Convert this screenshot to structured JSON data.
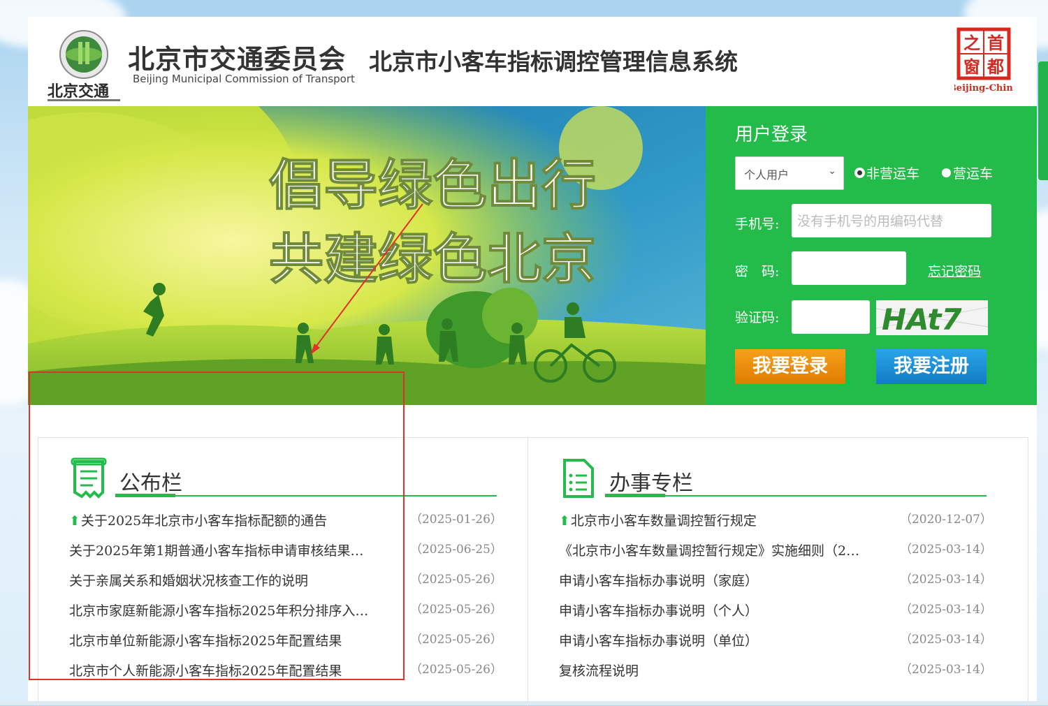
{
  "header": {
    "org_cn": "北京市交通委员会",
    "org_en": "Beijing Municipal Commission of Transport",
    "logo_text": "北京交通",
    "system_title": "北京市小客车指标调控管理信息系统",
    "stamp_chars": [
      "之",
      "首",
      "窗",
      "都"
    ],
    "stamp_en": "Beijing-China"
  },
  "banner": {
    "slogan_line1": "倡导绿色出行",
    "slogan_line2": "共建绿色北京"
  },
  "login": {
    "title": "用户登录",
    "user_type_selected": "个人用户",
    "vehicle_type_options": [
      "非营运车",
      "营运车"
    ],
    "vehicle_type_selected": "非营运车",
    "phone_label": "手机号:",
    "phone_placeholder": "没有手机号的用编码代替",
    "password_label": "密　码:",
    "forgot_password": "忘记密码",
    "captcha_label": "验证码:",
    "captcha_text": "HAt7",
    "login_button": "我要登录",
    "register_button": "我要注册"
  },
  "bulletin": {
    "title": "公布栏",
    "items": [
      {
        "text": "关于2025年北京市小客车指标配额的通告",
        "date": "（2025-01-26）",
        "pinned": true
      },
      {
        "text": "关于2025年第1期普通小客车指标申请审核结果…",
        "date": "（2025-06-25）",
        "pinned": false
      },
      {
        "text": "关于亲属关系和婚姻状况核查工作的说明",
        "date": "（2025-05-26）",
        "pinned": false
      },
      {
        "text": "北京市家庭新能源小客车指标2025年积分排序入…",
        "date": "（2025-05-26）",
        "pinned": false
      },
      {
        "text": "北京市单位新能源小客车指标2025年配置结果",
        "date": "（2025-05-26）",
        "pinned": false
      },
      {
        "text": "北京市个人新能源小客车指标2025年配置结果",
        "date": "（2025-05-26）",
        "pinned": false
      }
    ]
  },
  "services": {
    "title": "办事专栏",
    "items": [
      {
        "text": "北京市小客车数量调控暂行规定",
        "date": "（2020-12-07）",
        "pinned": true
      },
      {
        "text": "《北京市小客车数量调控暂行规定》实施细则（2…",
        "date": "（2025-03-14）",
        "pinned": false
      },
      {
        "text": "申请小客车指标办事说明（家庭）",
        "date": "（2025-03-14）",
        "pinned": false
      },
      {
        "text": "申请小客车指标办事说明（个人）",
        "date": "（2025-03-14）",
        "pinned": false
      },
      {
        "text": "申请小客车指标办事说明（单位）",
        "date": "（2025-03-14）",
        "pinned": false
      },
      {
        "text": "复核流程说明",
        "date": "（2025-03-14）",
        "pinned": false
      }
    ]
  },
  "colors": {
    "brand_green": "#23bc4a",
    "login_orange": "#f08a0c",
    "register_blue": "#1a8fd6",
    "annotation_red": "#e0322b"
  }
}
